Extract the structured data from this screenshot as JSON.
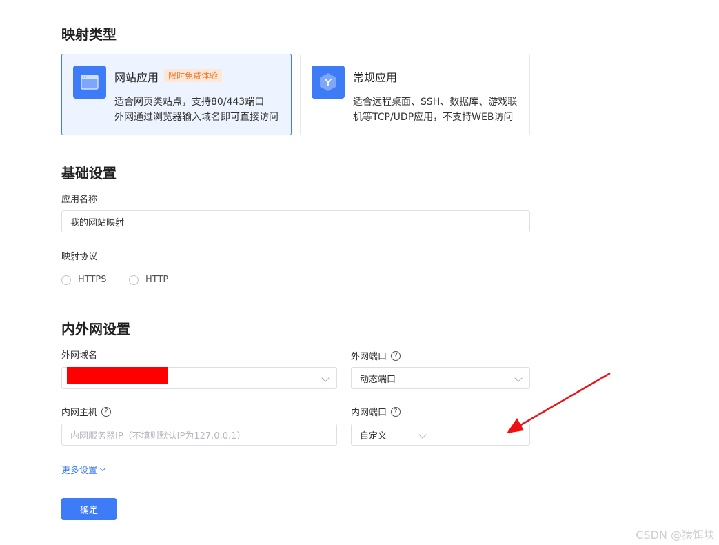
{
  "sections": {
    "mapping_type": "映射类型",
    "basic": "基础设置",
    "network": "内外网设置"
  },
  "cards": {
    "web": {
      "title": "网站应用",
      "badge": "限时免费体验",
      "desc_line1": "适合网页类站点，支持80/443端口",
      "desc_line2": "外网通过浏览器输入域名即可直接访问"
    },
    "general": {
      "title": "常规应用",
      "desc_line1": "适合远程桌面、SSH、数据库、游戏联",
      "desc_line2": "机等TCP/UDP应用，不支持WEB访问"
    }
  },
  "form": {
    "app_name_label": "应用名称",
    "app_name_value": "我的网站映射",
    "protocol_label": "映射协议",
    "protocol_options": [
      "HTTPS",
      "HTTP"
    ],
    "external_domain_label": "外网域名",
    "external_port_label": "外网端口",
    "external_port_value": "动态端口",
    "internal_host_label": "内网主机",
    "internal_host_placeholder": "内网服务器IP（不填则默认IP为127.0.0.1）",
    "internal_port_label": "内网端口",
    "internal_port_mode": "自定义",
    "internal_port_value": "",
    "help_symbol": "?"
  },
  "more_settings": "更多设置",
  "submit": "确定",
  "watermark": "CSDN @猿饵块",
  "colors": {
    "primary": "#3d7bf7",
    "badge_text": "#f07a2a",
    "badge_bg": "#fde7d8",
    "annotation_arrow": "#ee1111",
    "redaction": "#ff0000"
  }
}
